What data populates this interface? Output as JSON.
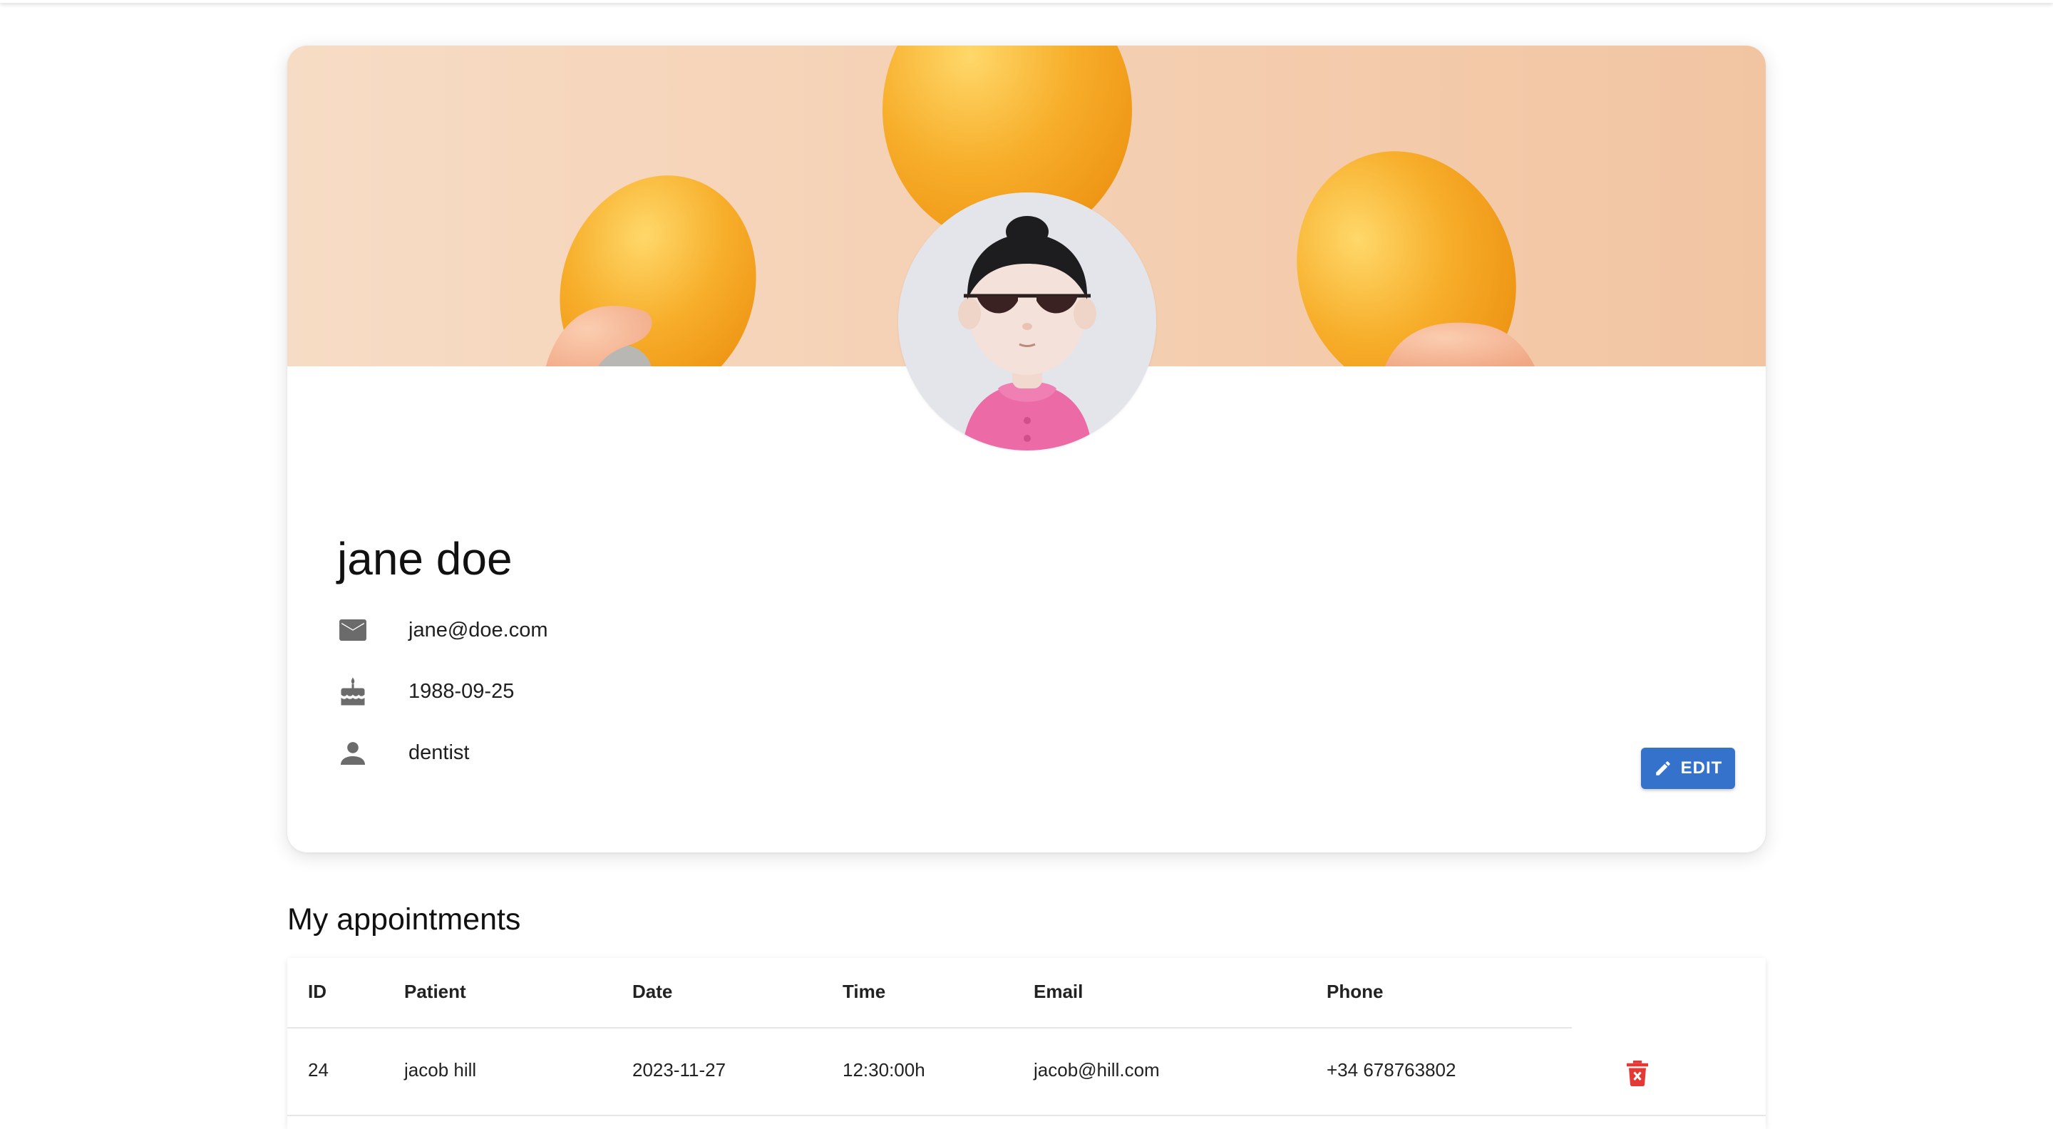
{
  "profile": {
    "name": "jane doe",
    "email": "jane@doe.com",
    "birthdate": "1988-09-25",
    "role": "dentist",
    "edit_label": "EDIT"
  },
  "icons": {
    "email": "mail-icon",
    "birthdate": "cake-icon",
    "role": "person-icon",
    "edit": "pencil-icon",
    "delete": "trash-icon"
  },
  "appointments": {
    "title": "My appointments",
    "columns": [
      "ID",
      "Patient",
      "Date",
      "Time",
      "Email",
      "Phone"
    ],
    "rows": [
      {
        "id": "24",
        "patient": "jacob hill",
        "date": "2023-11-27",
        "time": "12:30:00h",
        "email": "jacob@hill.com",
        "phone": "+34 678763802"
      }
    ]
  },
  "colors": {
    "accent": "#3572cc",
    "delete": "#e53935",
    "banner": "#f5d2b6",
    "icon_gray": "#6b6b6b"
  }
}
